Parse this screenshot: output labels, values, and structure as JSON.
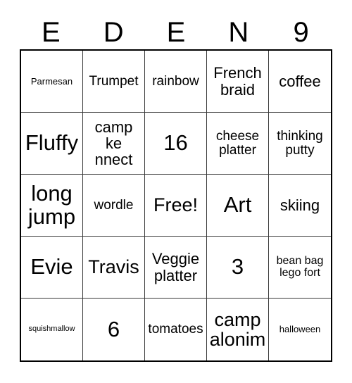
{
  "card": {
    "title_letters": [
      "E",
      "D",
      "E",
      "N",
      "9"
    ],
    "columns": 5,
    "rows": 5,
    "free_space_label": "Free!",
    "colors": {
      "text": "#000000",
      "background": "#ffffff",
      "outer_border": "#000000",
      "inner_border": "#3a3a3a"
    },
    "cells": [
      {
        "text": "Parmesan",
        "size": "xs"
      },
      {
        "text": "Trumpet",
        "size": "md"
      },
      {
        "text": "rainbow",
        "size": "md"
      },
      {
        "text": "French braid",
        "size": "lg"
      },
      {
        "text": "coffee",
        "size": "lg"
      },
      {
        "text": "Fluffy",
        "size": "xxl"
      },
      {
        "text": "camp ke nnect",
        "size": "lg"
      },
      {
        "text": "16",
        "size": "xxl"
      },
      {
        "text": "cheese platter",
        "size": "md"
      },
      {
        "text": "thinking putty",
        "size": "md"
      },
      {
        "text": "long jump",
        "size": "xxl"
      },
      {
        "text": "wordle",
        "size": "md"
      },
      {
        "text": "Free!",
        "size": "xl"
      },
      {
        "text": "Art",
        "size": "xxl"
      },
      {
        "text": "skiing",
        "size": "lg"
      },
      {
        "text": "Evie",
        "size": "xxl"
      },
      {
        "text": "Travis",
        "size": "xl"
      },
      {
        "text": "Veggie platter",
        "size": "lg"
      },
      {
        "text": "3",
        "size": "xxl"
      },
      {
        "text": "bean bag lego fort",
        "size": "sm"
      },
      {
        "text": "squishmallow",
        "size": "xxs"
      },
      {
        "text": "6",
        "size": "xxl"
      },
      {
        "text": "tomatoes",
        "size": "md"
      },
      {
        "text": "camp alonim",
        "size": "xl"
      },
      {
        "text": "halloween",
        "size": "xs"
      }
    ]
  }
}
